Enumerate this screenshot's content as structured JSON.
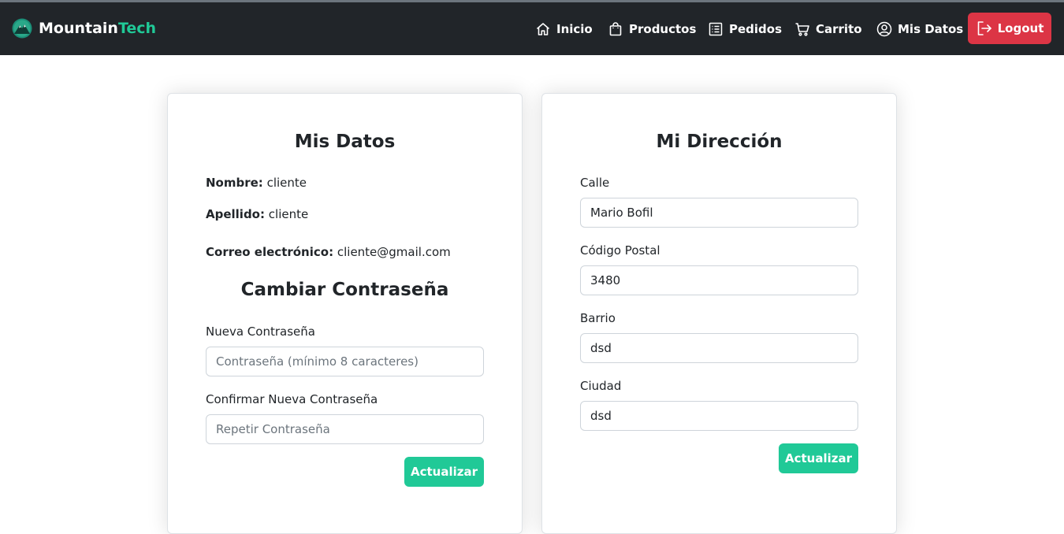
{
  "navbar": {
    "brand": {
      "name_part1": "Mountain",
      "name_part2": "Tech"
    },
    "items": [
      {
        "label": "Inicio",
        "icon": "house-icon"
      },
      {
        "label": "Productos",
        "icon": "bag-icon"
      },
      {
        "label": "Pedidos",
        "icon": "list-icon"
      },
      {
        "label": "Carrito",
        "icon": "cart-icon"
      },
      {
        "label": "Mis Datos",
        "icon": "user-circle-icon"
      }
    ],
    "logout_label": "Logout",
    "logout_icon": "logout-icon"
  },
  "colors": {
    "navbar_bg": "#212529",
    "accent": "#20c997",
    "logout": "#dc3545"
  },
  "mis_datos": {
    "title": "Mis Datos",
    "nombre_label": "Nombre:",
    "nombre_value": "cliente",
    "apellido_label": "Apellido:",
    "apellido_value": "cliente",
    "correo_label": "Correo electrónico:",
    "correo_value": "cliente@gmail.com"
  },
  "password": {
    "title": "Cambiar Contraseña",
    "new_label": "Nueva Contraseña",
    "new_placeholder": "Contraseña (mínimo 8 caracteres)",
    "confirm_label": "Confirmar Nueva Contraseña",
    "confirm_placeholder": "Repetir Contraseña",
    "button": "Actualizar"
  },
  "address": {
    "title": "Mi Dirección",
    "calle_label": "Calle",
    "calle_value": "Mario Bofil",
    "cp_label": "Código Postal",
    "cp_value": "3480",
    "barrio_label": "Barrio",
    "barrio_value": "dsd",
    "ciudad_label": "Ciudad",
    "ciudad_value": "dsd",
    "button": "Actualizar"
  }
}
